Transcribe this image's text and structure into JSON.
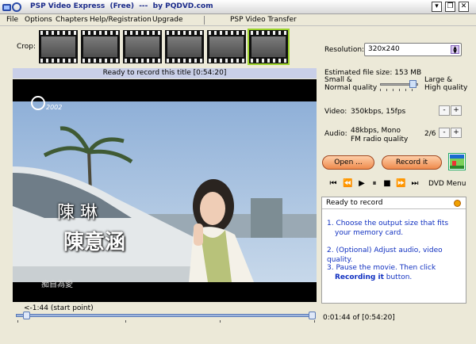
{
  "window": {
    "title": "PSP Video Express  (Free)  ---  by PQDVD.com"
  },
  "menu": {
    "items": [
      "File",
      "Options",
      "Chapters",
      "Help/Registration",
      "Upgrade"
    ],
    "right_title": "PSP  Video Transfer"
  },
  "crop": {
    "label": "Crop:",
    "thumbnail_count": 6,
    "selected_index": 5
  },
  "player": {
    "status": "Ready to record this title [0:54:20]",
    "overlay_name": "陳 琳",
    "overlay_title": "陳意涵",
    "overlay_caption": "痴自為愛",
    "channel_logo": "2002",
    "start_point_label": "<-1:44 (start point)",
    "time_readout": "0:01:44 of [0:54:20]",
    "position_fraction": 0.03
  },
  "settings": {
    "resolution_label": "Resolution:",
    "resolution_value": "320x240",
    "estimated_label": "Estimated file size:  153 MB",
    "quality_low_1": "Small &",
    "quality_low_2": "Normal quality",
    "quality_high_1": "Large &",
    "quality_high_2": "High quality",
    "quality_fraction": 0.85,
    "video_label": "Video:",
    "video_value": "350kbps, 15fps",
    "audio_label": "Audio:",
    "audio_value_1": "48kbps, Mono",
    "audio_value_2": "FM radio quality",
    "audio_step": "2/6",
    "minus": "-",
    "plus": "+"
  },
  "actions": {
    "open_label": "Open ...",
    "record_label": "Record it",
    "dvd_menu_label": "DVD Menu"
  },
  "info": {
    "header": "Ready to record",
    "step1_a": "1. Choose the output size that fits",
    "step1_b": "your memory card.",
    "step2": "2. (Optional) Adjust audio, video quality.",
    "step3_a": "3. Pause the movie. Then click",
    "step3_bold": "Recording it",
    "step3_tail": " button."
  },
  "icons": {
    "transport": [
      "skip-start-icon",
      "rewind-icon",
      "play-icon",
      "pause-icon",
      "stop-icon",
      "fast-forward-icon",
      "skip-end-icon"
    ]
  },
  "colors": {
    "status_bar": "#c9cfe8",
    "button_orange": "#ef8a4c",
    "step_text": "#1030c0"
  }
}
